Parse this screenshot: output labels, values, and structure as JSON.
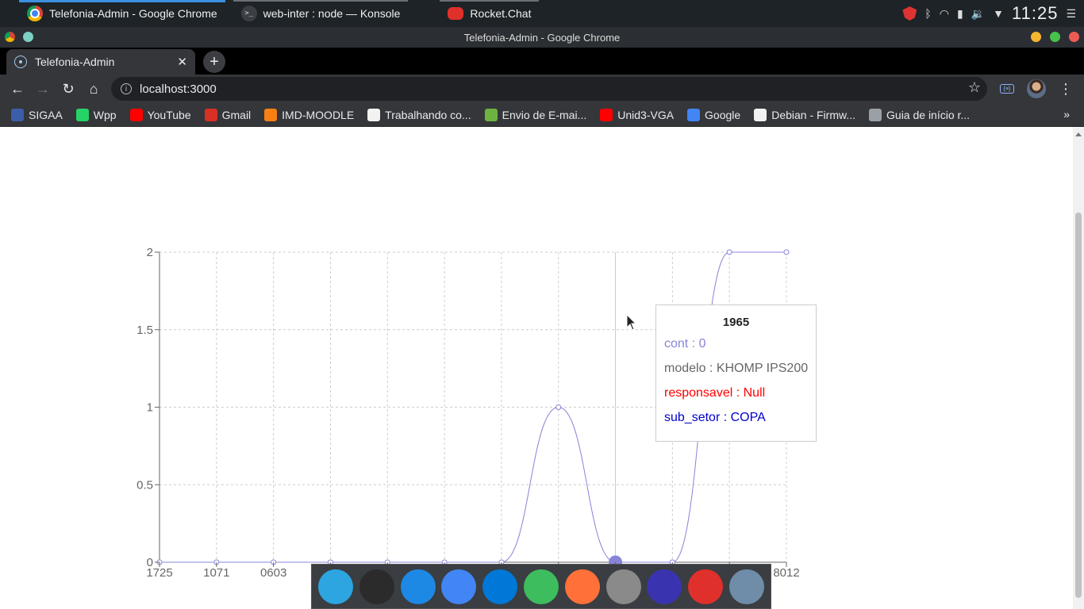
{
  "os": {
    "tasks": [
      {
        "label": "Telefonia-Admin - Google Chrome"
      },
      {
        "label": "web-inter : node — Konsole"
      },
      {
        "label": "Rocket.Chat"
      }
    ],
    "clock": "11:25"
  },
  "window": {
    "title": "Telefonia-Admin - Google Chrome"
  },
  "browser": {
    "tab_title": "Telefonia-Admin",
    "url": "localhost:3000",
    "bookmarks": [
      {
        "label": "SIGAA",
        "icon": "sigaa-icon",
        "color": "#3b5ea8"
      },
      {
        "label": "Wpp",
        "icon": "whatsapp-icon",
        "color": "#25d366"
      },
      {
        "label": "YouTube",
        "icon": "youtube-icon",
        "color": "#ff0000"
      },
      {
        "label": "Gmail",
        "icon": "gmail-icon",
        "color": "#d93025"
      },
      {
        "label": "IMD-MOODLE",
        "icon": "moodle-icon",
        "color": "#f98012"
      },
      {
        "label": "Trabalhando co...",
        "icon": "tux-icon",
        "color": "#f2f2f2"
      },
      {
        "label": "Envio de E-mai...",
        "icon": "leaf-icon",
        "color": "#6db33f"
      },
      {
        "label": "Unid3-VGA",
        "icon": "youtube-icon",
        "color": "#ff0000"
      },
      {
        "label": "Google",
        "icon": "google-icon",
        "color": "#4285f4"
      },
      {
        "label": "Debian - Firmw...",
        "icon": "tux-icon",
        "color": "#f2f2f2"
      },
      {
        "label": "Guia de início r...",
        "icon": "doc-icon",
        "color": "#9aa0a6"
      }
    ]
  },
  "chart_data": {
    "type": "line",
    "title": "",
    "xlabel": "",
    "ylabel": "",
    "ylim": [
      0,
      2
    ],
    "yticks": [
      "0",
      "0.5",
      "1",
      "1.5",
      "2"
    ],
    "categories": [
      "1725",
      "1071",
      "0603",
      "",
      "",
      "",
      "",
      "",
      "1965",
      "",
      "",
      "8012"
    ],
    "series": [
      {
        "name": "cont",
        "color": "#8884d8",
        "values": [
          0,
          0,
          0,
          0,
          0,
          0,
          0,
          1,
          0,
          0,
          2,
          2
        ]
      }
    ],
    "grid": true,
    "active_index": 8
  },
  "tooltip": {
    "title": "1965",
    "rows": [
      {
        "text": "cont : 0",
        "color": "#8884d8"
      },
      {
        "text": "modelo : KHOMP IPS200",
        "color": "#666666"
      },
      {
        "text": "responsavel : Null",
        "color": "#ff0000"
      },
      {
        "text": "sub_setor : COPA",
        "color": "#0000cc"
      }
    ]
  },
  "dock": [
    {
      "icon": "telegram-icon",
      "color": "#2ca5e0"
    },
    {
      "icon": "terminal-icon",
      "color": "#2b2b2b"
    },
    {
      "icon": "finder-icon",
      "color": "#1e88e5"
    },
    {
      "icon": "chrome-icon",
      "color": "#4285f4"
    },
    {
      "icon": "vscode-icon",
      "color": "#0078d7"
    },
    {
      "icon": "music-icon",
      "color": "#3dbd5d"
    },
    {
      "icon": "firefox-icon",
      "color": "#ff7139"
    },
    {
      "icon": "settings-icon",
      "color": "#8a8a8a"
    },
    {
      "icon": "moon-icon",
      "color": "#3a33b0"
    },
    {
      "icon": "rocketchat-icon",
      "color": "#e0302c"
    },
    {
      "icon": "camera-icon",
      "color": "#6f8da8"
    }
  ]
}
